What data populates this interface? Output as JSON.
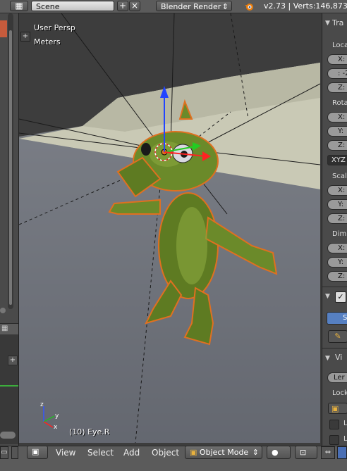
{
  "topbar": {
    "scene_label": "Scene",
    "render_engine": "Blender Render",
    "stats": "v2.73 | Verts:146,873"
  },
  "viewport": {
    "view_name": "User Persp",
    "units": "Meters",
    "active_object": "(10) Eye.R"
  },
  "right_panel": {
    "section_transform": "Tra",
    "location_label": "Loca",
    "loc_x": "X:",
    "loc_y": ": -2",
    "loc_z": "Z:",
    "rotation_label": "Rota",
    "rot_x": "X:",
    "rot_y": "Y:",
    "rot_z": "Z:",
    "rotation_mode": "XYZ",
    "scale_label": "Scal",
    "scale_x": "X:",
    "scale_y": "Y:",
    "scale_z": "Z:",
    "dimensions_label": "Dim",
    "dim_x": "X:",
    "dim_y": "Y:",
    "dim_z": "Z:",
    "grease_btn": "Sc",
    "view_section": "Vi",
    "lens_field": "Ler",
    "lock_label": "Lock",
    "lock_item_1": "L",
    "lock_item_2": "L"
  },
  "bottombar": {
    "menu_view": "View",
    "menu_select": "Select",
    "menu_add": "Add",
    "menu_object": "Object",
    "mode": "Object Mode"
  },
  "colors": {
    "header_bg": "#5b5b5b",
    "panel_bg": "#4a4a4a",
    "character_green": "#6b8a2a",
    "selection_outline": "#e07020"
  }
}
